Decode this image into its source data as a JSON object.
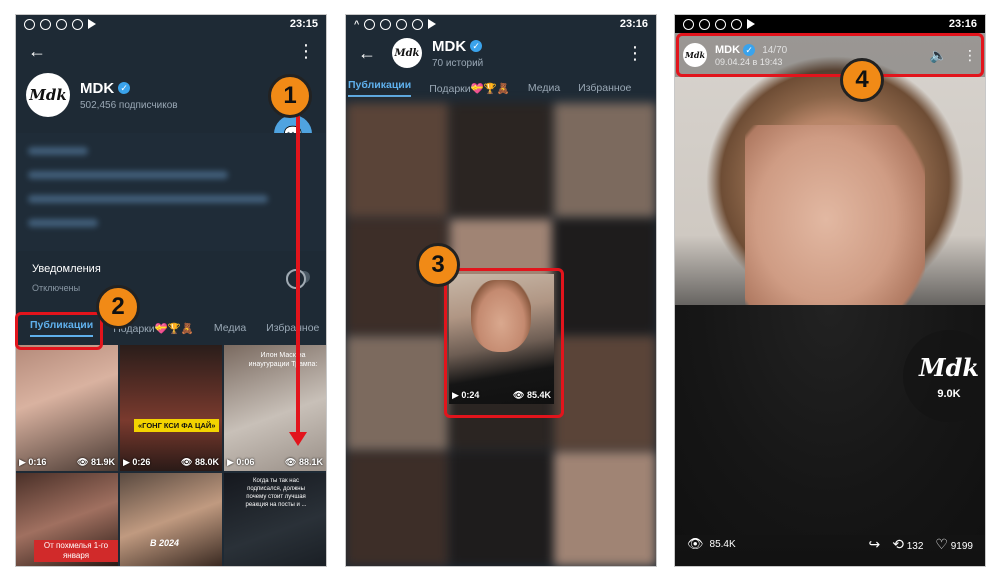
{
  "status_bar": {
    "time_1": "23:15",
    "time_2": "23:16",
    "time_3": "23:16"
  },
  "profile": {
    "name": "MDK",
    "subscribers": "502,456 подписчиков",
    "notifications_label": "Уведомления",
    "notifications_status": "Отключены"
  },
  "tabs": {
    "publications": "Публикации",
    "gifts": "Подарки💝🏆🧸",
    "gifts_short": "Подарки💝🏆🧸",
    "media": "Медиа",
    "favorites_truncated": "Избранное",
    "favorites": "Избранное"
  },
  "grid_posts": [
    {
      "duration": "0:16",
      "views": "81.9K"
    },
    {
      "duration": "0:26",
      "views": "88.0K",
      "caption": "«ГОНГ КСИ ФА ЦАЙ»"
    },
    {
      "duration": "0:06",
      "views": "88.1K",
      "caption": "Илон Маск на инаугурации Трампа:"
    },
    {
      "caption": "От похмелья 1-го января"
    },
    {
      "caption": "В 2024"
    },
    {
      "caption": "Когда ты так нас подписался, должны почему стоит лучшая реакция на посты и ..."
    }
  ],
  "stories_header": {
    "title": "MDK",
    "subtitle": "70 историй"
  },
  "selected_story": {
    "duration": "0:24",
    "views": "85.4K"
  },
  "story_view": {
    "author": "MDK",
    "counter": "14/70",
    "date": "09.04.24 в 19:43",
    "badge_views": "9.0K",
    "views": "85.4K",
    "reposts": "132",
    "likes": "9199"
  },
  "markers": [
    "1",
    "2",
    "3",
    "4"
  ],
  "colors": {
    "accent": "#5fb0ec",
    "highlight": "#e2141c",
    "marker": "#f18a16",
    "app_bg": "#1e2a35"
  }
}
